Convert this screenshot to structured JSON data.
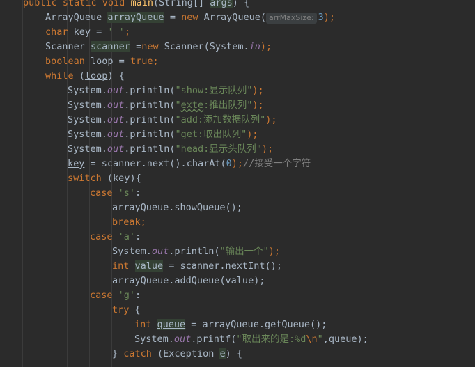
{
  "code_lines": [
    {
      "indent": 0,
      "tokens": [
        {
          "t": "public static void ",
          "c": "kw"
        },
        {
          "t": "main",
          "c": "fn"
        },
        {
          "t": "(String[] "
        },
        {
          "t": "args",
          "c": "hl"
        },
        {
          "t": ") {"
        }
      ]
    },
    {
      "indent": 1,
      "tokens": [
        {
          "t": "ArrayQueue "
        },
        {
          "t": "arrayQueue",
          "c": "hl"
        },
        {
          "t": " = "
        },
        {
          "t": "new ",
          "c": "kw"
        },
        {
          "t": "ArrayQueue("
        },
        {
          "t": "arrMaxSize:",
          "c": "hint"
        },
        {
          "t": "3",
          "c": "num"
        },
        {
          "t": ");",
          "c": "kw"
        }
      ]
    },
    {
      "indent": 1,
      "tokens": [
        {
          "t": "char ",
          "c": "kw"
        },
        {
          "t": "key",
          "c": "ul"
        },
        {
          "t": " = "
        },
        {
          "t": "' '",
          "c": "str"
        },
        {
          "t": ";",
          "c": "kw"
        }
      ]
    },
    {
      "indent": 1,
      "tokens": [
        {
          "t": "Scanner "
        },
        {
          "t": "scanner",
          "c": "hl"
        },
        {
          "t": " ="
        },
        {
          "t": "new ",
          "c": "kw"
        },
        {
          "t": "Scanner(System."
        },
        {
          "t": "in",
          "c": "fld"
        },
        {
          "t": ");",
          "c": "kw"
        }
      ]
    },
    {
      "indent": 1,
      "tokens": [
        {
          "t": "boolean ",
          "c": "kw"
        },
        {
          "t": "loop",
          "c": "ul"
        },
        {
          "t": " = "
        },
        {
          "t": "true",
          "c": "kw"
        },
        {
          "t": ";",
          "c": "kw"
        }
      ]
    },
    {
      "indent": 1,
      "tokens": [
        {
          "t": "while ",
          "c": "kw"
        },
        {
          "t": "("
        },
        {
          "t": "loop",
          "c": "ul"
        },
        {
          "t": ") {"
        }
      ]
    },
    {
      "indent": 2,
      "tokens": [
        {
          "t": "System."
        },
        {
          "t": "out",
          "c": "fld"
        },
        {
          "t": ".println("
        },
        {
          "t": "\"show:显示队列\"",
          "c": "str"
        },
        {
          "t": ");",
          "c": "kw"
        }
      ]
    },
    {
      "indent": 2,
      "tokens": [
        {
          "t": "System."
        },
        {
          "t": "out",
          "c": "fld"
        },
        {
          "t": ".println("
        },
        {
          "t": "\"",
          "c": "str"
        },
        {
          "t": "exte",
          "c": "str squig"
        },
        {
          "t": ":推出队列\"",
          "c": "str"
        },
        {
          "t": ");",
          "c": "kw"
        }
      ]
    },
    {
      "indent": 2,
      "tokens": [
        {
          "t": "System."
        },
        {
          "t": "out",
          "c": "fld"
        },
        {
          "t": ".println("
        },
        {
          "t": "\"add:添加数据队列\"",
          "c": "str"
        },
        {
          "t": ");",
          "c": "kw"
        }
      ]
    },
    {
      "indent": 2,
      "tokens": [
        {
          "t": "System."
        },
        {
          "t": "out",
          "c": "fld"
        },
        {
          "t": ".println("
        },
        {
          "t": "\"get:取出队列\"",
          "c": "str"
        },
        {
          "t": ");",
          "c": "kw"
        }
      ]
    },
    {
      "indent": 2,
      "tokens": [
        {
          "t": "System."
        },
        {
          "t": "out",
          "c": "fld"
        },
        {
          "t": ".println("
        },
        {
          "t": "\"head:显示头队列\"",
          "c": "str"
        },
        {
          "t": ");",
          "c": "kw"
        }
      ]
    },
    {
      "indent": 2,
      "tokens": [
        {
          "t": "key",
          "c": "ul"
        },
        {
          "t": " = scanner.next().charAt("
        },
        {
          "t": "0",
          "c": "num"
        },
        {
          "t": ");",
          "c": "kw"
        },
        {
          "t": "//接受一个字符",
          "c": "cm"
        }
      ]
    },
    {
      "indent": 2,
      "tokens": [
        {
          "t": "switch ",
          "c": "kw"
        },
        {
          "t": "("
        },
        {
          "t": "key",
          "c": "ul"
        },
        {
          "t": "){"
        }
      ]
    },
    {
      "indent": 3,
      "tokens": [
        {
          "t": "case ",
          "c": "kw"
        },
        {
          "t": "'s'",
          "c": "str"
        },
        {
          "t": ":"
        }
      ]
    },
    {
      "indent": 4,
      "tokens": [
        {
          "t": "arrayQueue.showQueue();"
        }
      ]
    },
    {
      "indent": 4,
      "tokens": [
        {
          "t": "break;",
          "c": "kw"
        }
      ]
    },
    {
      "indent": 3,
      "tokens": [
        {
          "t": "case ",
          "c": "kw"
        },
        {
          "t": "'a'",
          "c": "str"
        },
        {
          "t": ":"
        }
      ]
    },
    {
      "indent": 4,
      "tokens": [
        {
          "t": "System."
        },
        {
          "t": "out",
          "c": "fld"
        },
        {
          "t": ".println("
        },
        {
          "t": "\"输出一个\"",
          "c": "str"
        },
        {
          "t": ");",
          "c": "kw"
        }
      ]
    },
    {
      "indent": 4,
      "tokens": [
        {
          "t": "int ",
          "c": "kw"
        },
        {
          "t": "value",
          "c": "hl"
        },
        {
          "t": " = scanner.nextInt();"
        }
      ]
    },
    {
      "indent": 4,
      "tokens": [
        {
          "t": "arrayQueue.addQueue(value);"
        }
      ]
    },
    {
      "indent": 3,
      "tokens": [
        {
          "t": "case ",
          "c": "kw"
        },
        {
          "t": "'g'",
          "c": "str"
        },
        {
          "t": ":"
        }
      ]
    },
    {
      "indent": 4,
      "tokens": [
        {
          "t": "try ",
          "c": "kw"
        },
        {
          "t": "{"
        }
      ]
    },
    {
      "indent": 5,
      "tokens": [
        {
          "t": "int ",
          "c": "kw"
        },
        {
          "t": "queue",
          "c": "hl ul"
        },
        {
          "t": " = arrayQueue.getQueue();"
        }
      ]
    },
    {
      "indent": 5,
      "tokens": [
        {
          "t": "System."
        },
        {
          "t": "out",
          "c": "fld"
        },
        {
          "t": ".printf("
        },
        {
          "t": "\"取出来的是:%d",
          "c": "str"
        },
        {
          "t": "\\n",
          "c": "esc"
        },
        {
          "t": "\"",
          "c": "str"
        },
        {
          "t": ",queue);"
        }
      ]
    },
    {
      "indent": 4,
      "tokens": [
        {
          "t": "} "
        },
        {
          "t": "catch ",
          "c": "kw"
        },
        {
          "t": "(Exception "
        },
        {
          "t": "e",
          "c": "hl"
        },
        {
          "t": ") {"
        }
      ]
    }
  ]
}
